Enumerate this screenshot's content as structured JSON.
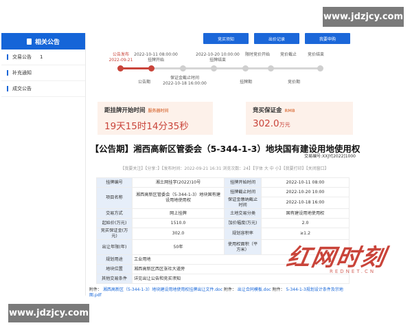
{
  "watermark": {
    "text": "www.jdzjcy.com"
  },
  "sidebar": {
    "title": "相关公告",
    "items": [
      {
        "label": "交易公告",
        "count": "1"
      },
      {
        "label": "补充通知"
      },
      {
        "label": "成交公告"
      }
    ]
  },
  "toolbar": {
    "buttons": [
      "竞买须知",
      "出价记录",
      "我要申购"
    ]
  },
  "timeline": {
    "steps": [
      {
        "line1": "公告发布",
        "line2": "2022-09-21"
      },
      {
        "line1": "2022-10-11 08:00:00",
        "line2": "挂牌开始"
      },
      {
        "line1": "保证金截止时间",
        "line2": "2022-10-18 16:00:00",
        "below": "公告期"
      },
      {
        "line1": "2022-10-20 10:00:00",
        "line2": "挂牌结束"
      },
      {
        "line1": "限时竞价开始"
      },
      {
        "line1": "竞价截止",
        "below": "竞价期"
      },
      {
        "line1": "竞价结束"
      }
    ],
    "phase_labels": [
      "公告期",
      "挂牌期",
      "竞价期"
    ]
  },
  "countdown": {
    "label": "距挂牌开始时间",
    "tag": "服务器时间",
    "value": "19天15时14分35秒"
  },
  "deposit": {
    "label": "竞买保证金",
    "tag": "RMB",
    "value": "302.0",
    "unit": "万元"
  },
  "title": "【公告期】湘西高新区管委会（5-344-1-3）地块国有建设用地使用权",
  "trade_no": "交易编号:XXJY[2022]1000",
  "meta_line": "【我要关注】【分享：】【发布时间：2022-09-21 16:31 浏览次数：24】【字体 大 中 小】【我要打印】【关闭窗口】",
  "table": {
    "rows": [
      [
        "挂牌编号",
        "湘土网挂字(2022)10号",
        "挂牌开始时间",
        "2022-10-11 08:00"
      ],
      [
        "项目名称",
        "湘西高新区管委会（5-344-1-3）地块国有建设用地使用权",
        "挂牌截止时间",
        "2022-10-20 10:00"
      ],
      [
        "",
        "",
        "保证金缴纳截止时间",
        "2022-10-18 16:00"
      ],
      [
        "交易方式",
        "网上挂牌",
        "土地交易分类",
        "国有建设用地使用权"
      ],
      [
        "起始价(万元)",
        "1510.0",
        "加价幅度(万元)",
        "2.0"
      ],
      [
        "竞买保证金(万元)",
        "302.0",
        "规划容积率",
        "≥1.2"
      ],
      [
        "出让年限(年)",
        "50年",
        "使用权面积（平方米）",
        ""
      ],
      [
        "规划用途",
        "工业用地",
        "",
        ""
      ],
      [
        "地块位置",
        "湘西高新区西区张社大道旁",
        "",
        ""
      ],
      [
        "其他交易条件",
        "详见出让公告和竞买须知",
        "",
        ""
      ]
    ]
  },
  "attachments": {
    "label": "附件：",
    "files": [
      "湘西高新区（5-344-1-3）地块建设用地使用权挂牌出让文件.doc",
      "出让合同模板.doc",
      "5-344-1-3规划设计条件及宗地图.pdf"
    ],
    "sep": "附件："
  },
  "logo": {
    "main": "红网时刻",
    "sub": "REDNET.CN"
  },
  "colors": {
    "accent": "#1565d8",
    "red": "#c9443a",
    "peach": "#fdf1ea"
  }
}
